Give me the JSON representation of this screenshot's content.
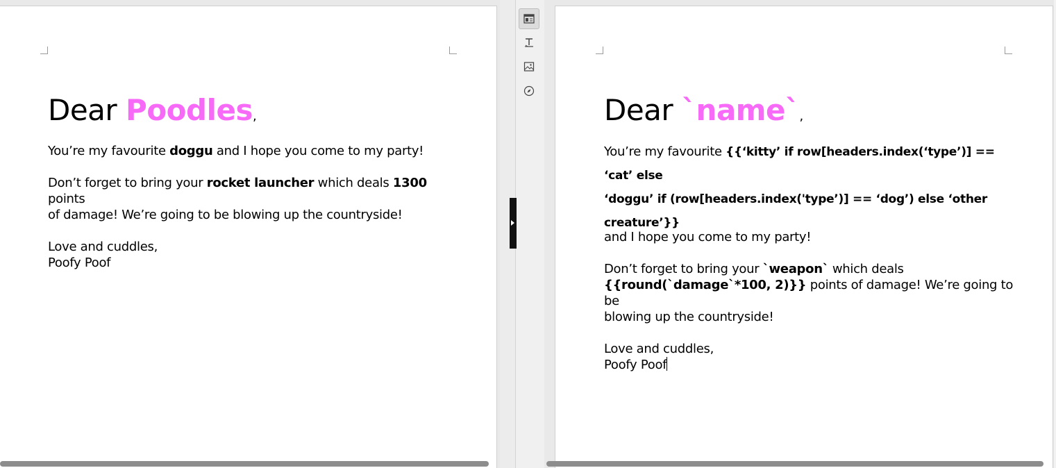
{
  "left_doc": {
    "greeting": "Dear ",
    "name": "Poodles",
    "comma": ",",
    "line1_pre": "You’re my favourite ",
    "line1_bold": "doggu",
    "line1_post": "  and I hope you come to my party!",
    "line2_pre": "Don’t forget to bring your ",
    "line2_weapon": "rocket launcher",
    "line2_mid": " which deals ",
    "line2_damage": "1300",
    "line2_post": " points",
    "line3": "of damage! We’re going to be blowing up the countryside!",
    "closing": "Love and cuddles,",
    "signature": "Poofy Poof"
  },
  "right_doc": {
    "greeting": "Dear ",
    "name": "`name`",
    "comma": ",",
    "line1_pre": "You’re my favourite ",
    "line1_expr_a": "{{‘kitty’ if row[headers.index(‘type’)] == ‘cat’ else",
    "line1_expr_b": "‘doggu’ if (row[headers.index('type’)] == ‘dog’) else ‘other creature’}}",
    "line1_post": "and I hope you come to my party!",
    "line2_pre": "Don’t forget to bring your ",
    "line2_weapon": "`weapon`",
    "line2_mid": " which deals",
    "line3_expr": "{{round(`damage`*100, 2)}}",
    "line3_post": " points of damage! We’re going to be",
    "line4": "blowing up the countryside!",
    "closing": "Love and cuddles,",
    "signature": "Poofy Poof"
  },
  "sidebar": {
    "icons": [
      "properties-icon",
      "styles-icon",
      "gallery-icon",
      "navigator-icon"
    ]
  },
  "colors": {
    "accent_pink": "#f76af7"
  }
}
